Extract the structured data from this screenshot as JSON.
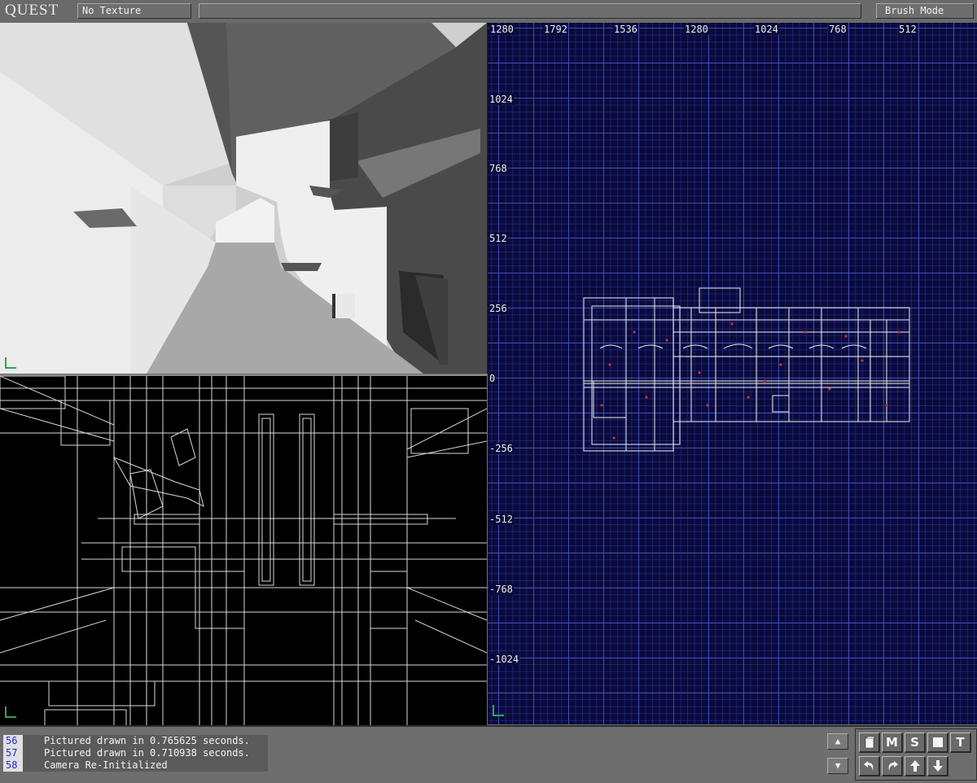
{
  "app": {
    "logo": "QUEST",
    "texture": "No Texture",
    "status": "",
    "mode_button": "Brush Mode"
  },
  "grid_view": {
    "x_labels": [
      "1280",
      "1792",
      "1536",
      "1280",
      "1024",
      "768",
      "512"
    ],
    "y_labels": [
      "1024",
      "768",
      "512",
      "256",
      "0",
      "-256",
      "-512",
      "-768",
      "-1024"
    ]
  },
  "console": {
    "lines": [
      {
        "num": "56",
        "text": "Pictured drawn in 0.765625 seconds."
      },
      {
        "num": "57",
        "text": "Pictured drawn in 0.710938 seconds."
      },
      {
        "num": "58",
        "text": "Camera Re-Initialized"
      }
    ]
  },
  "scroll": {
    "up": "▲",
    "down": "▼"
  },
  "toolbar": {
    "row1": [
      "cube-icon",
      "M",
      "S",
      "square-icon",
      "T"
    ],
    "row2": [
      "undo-icon",
      "redo-icon",
      "arrow-up-icon",
      "arrow-down-icon"
    ]
  }
}
